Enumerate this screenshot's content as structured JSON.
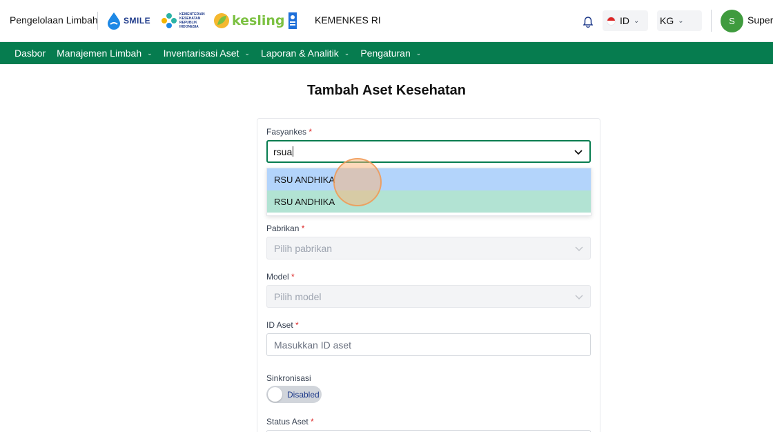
{
  "header": {
    "app_name": "Pengelolaan Limbah",
    "logos": {
      "smile": "SMILE",
      "kemenkes_small": "KEMENTERIAN KESEHATAN REPUBLIK INDONESIA",
      "kesling": "kesling"
    },
    "org": "KEMENKES RI",
    "language": "ID",
    "unit": "KG",
    "user_initial": "S",
    "user_name": "Super A"
  },
  "nav": {
    "items": [
      {
        "label": "Dasbor",
        "has_menu": false
      },
      {
        "label": "Manajemen Limbah",
        "has_menu": true
      },
      {
        "label": "Inventarisasi Aset",
        "has_menu": true
      },
      {
        "label": "Laporan & Analitik",
        "has_menu": true
      },
      {
        "label": "Pengaturan",
        "has_menu": true
      }
    ]
  },
  "page": {
    "title": "Tambah Aset Kesehatan"
  },
  "form": {
    "fasyankes": {
      "label": "Fasyankes",
      "required_mark": "*",
      "value": "rsua",
      "options": [
        "RSU ANDHIKA",
        "RSU ANDHIKA"
      ]
    },
    "pabrikan": {
      "label": "Pabrikan",
      "required_mark": "*",
      "placeholder": "Pilih pabrikan"
    },
    "model": {
      "label": "Model",
      "required_mark": "*",
      "placeholder": "Pilih model"
    },
    "id_aset": {
      "label": "ID Aset",
      "required_mark": "*",
      "placeholder": "Masukkan ID aset"
    },
    "sinkronisasi": {
      "label": "Sinkronisasi",
      "state": "Disabled"
    },
    "status_aset": {
      "label": "Status Aset",
      "required_mark": "*"
    }
  },
  "colors": {
    "brand_green": "#067c4f",
    "highlight_option": "#b3d4fb",
    "selected_option": "#b2e3d3",
    "avatar_green": "#3f9b3e"
  }
}
